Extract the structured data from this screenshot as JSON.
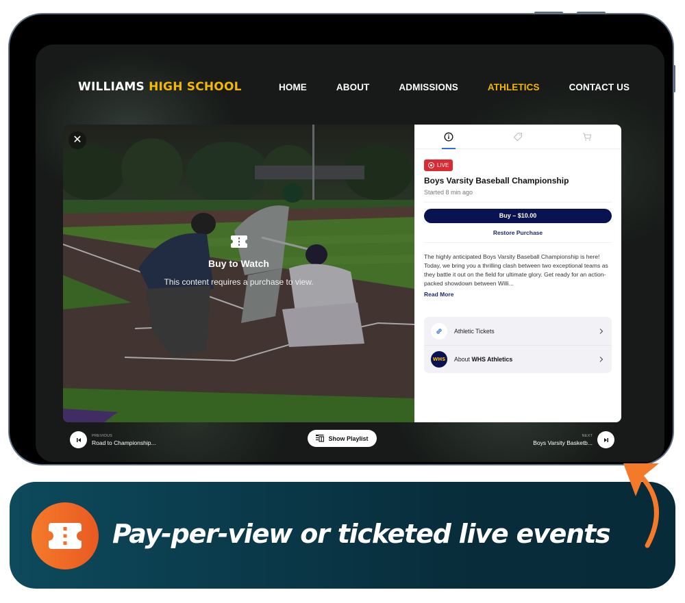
{
  "site": {
    "logo_part1": "WILLIAMS",
    "logo_part2": "HIGH SCHOOL",
    "nav": [
      {
        "label": "HOME",
        "active": false
      },
      {
        "label": "ABOUT",
        "active": false
      },
      {
        "label": "ADMISSIONS",
        "active": false
      },
      {
        "label": "ATHLETICS",
        "active": true
      },
      {
        "label": "CONTACT US",
        "active": false
      }
    ]
  },
  "player": {
    "close_icon": "close-icon",
    "overlay_icon": "ticket-icon",
    "overlay_title": "Buy to Watch",
    "overlay_subtitle": "This content requires a purchase to view."
  },
  "panel": {
    "tabs": [
      {
        "icon": "info-icon",
        "active": true
      },
      {
        "icon": "tag-icon",
        "active": false
      },
      {
        "icon": "cart-icon",
        "active": false
      }
    ],
    "live_badge": "LIVE",
    "event_title": "Boys Varsity Baseball Championship",
    "started": "Started 8 min ago",
    "buy_button": "Buy – $10.00",
    "restore_link": "Restore Purchase",
    "description": "The highly anticipated Boys Varsity Baseball Championship is here! Today, we bring you a thrilling clash between two exceptional teams as they battle it out on the field for ultimate glory. Get ready for an action-packed showdown between Willi...",
    "read_more": "Read More",
    "links": [
      {
        "icon": "link-icon",
        "label": "Athletic Tickets"
      },
      {
        "icon": "whs-logo",
        "icon_text": "WHS",
        "label_prefix": "About ",
        "label_bold": "WHS Athletics"
      }
    ]
  },
  "controls": {
    "previous_label": "PREVIOUS",
    "previous_title": "Road to Championship...",
    "playlist_button": "Show Playlist",
    "next_label": "NEXT",
    "next_title": "Boys Varsity Basketb..."
  },
  "banner": {
    "text": "Pay-per-view or ticketed live events",
    "icon": "ticket-icon"
  },
  "colors": {
    "accent_yellow": "#f5b800",
    "navy": "#0a1352",
    "live_red": "#dc2a34",
    "tab_blue": "#2d6cdf",
    "orange": "#f47a2a",
    "banner_teal": "#0a3848"
  }
}
